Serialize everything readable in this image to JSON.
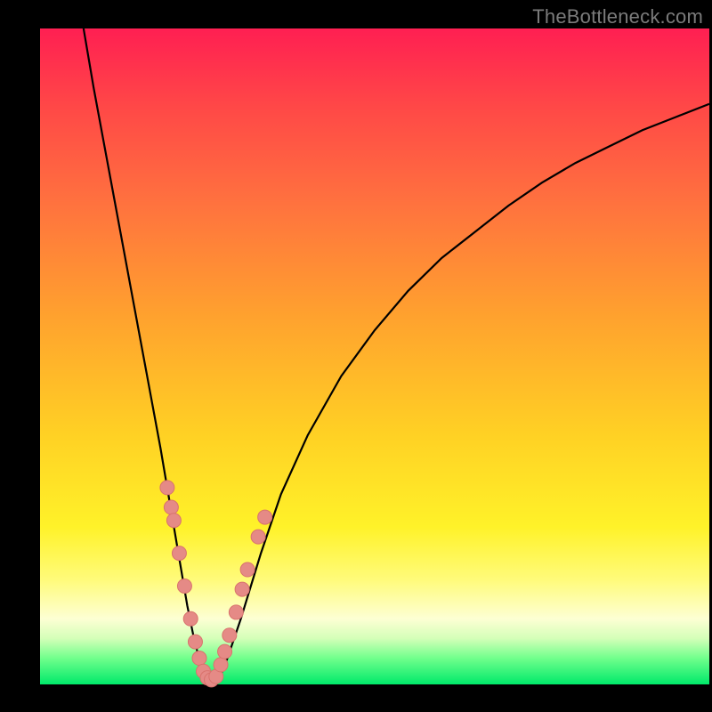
{
  "watermark": "TheBottleneck.com",
  "colors": {
    "curve_stroke": "#000000",
    "marker_fill": "#e58a86",
    "marker_stroke": "#d9736d",
    "frame_bg": "#000000"
  },
  "chart_data": {
    "type": "line",
    "title": "",
    "xlabel": "",
    "ylabel": "",
    "xlim": [
      0,
      100
    ],
    "ylim": [
      0,
      100
    ],
    "grid": false,
    "legend": false,
    "note": "No tick labels or axes are rendered; values are normalized 0–100 estimates read from the image. y=0 at bottom (green), y=100 at top (red).",
    "series": [
      {
        "name": "bottleneck-curve",
        "x": [
          6.5,
          8,
          10,
          12,
          14,
          16,
          18,
          19,
          20,
          21,
          22,
          23,
          24,
          25,
          26,
          27,
          28,
          30,
          33,
          36,
          40,
          45,
          50,
          55,
          60,
          65,
          70,
          75,
          80,
          85,
          90,
          95,
          100
        ],
        "y": [
          100,
          91,
          80,
          69,
          58,
          47,
          36,
          30,
          24,
          18,
          12,
          7,
          3,
          1,
          0.5,
          1.5,
          4,
          10,
          20,
          29,
          38,
          47,
          54,
          60,
          65,
          69,
          73,
          76.5,
          79.5,
          82,
          84.5,
          86.5,
          88.5
        ]
      },
      {
        "name": "highlighted-points",
        "style": "markers",
        "marker_radius_px": 8,
        "x": [
          19.0,
          19.6,
          20.0,
          20.8,
          21.6,
          22.5,
          23.2,
          23.8,
          24.4,
          25.0,
          25.6,
          26.3,
          27.0,
          27.6,
          28.3,
          29.3,
          30.2,
          31.0,
          32.6,
          33.6
        ],
        "y": [
          30.0,
          27.0,
          25.0,
          20.0,
          15.0,
          10.0,
          6.5,
          4.0,
          2.0,
          1.0,
          0.7,
          1.2,
          3.0,
          5.0,
          7.5,
          11.0,
          14.5,
          17.5,
          22.5,
          25.5
        ]
      }
    ]
  }
}
